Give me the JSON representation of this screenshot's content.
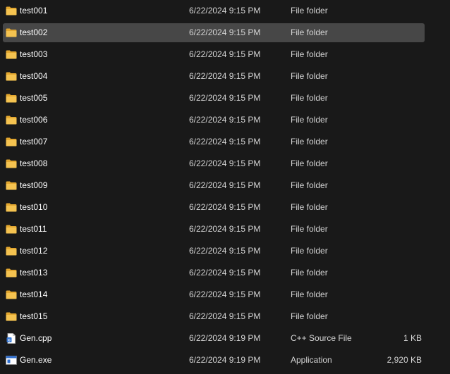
{
  "colors": {
    "background": "#191919",
    "selected_row": "#474747",
    "folder_yellow": "#f5c350",
    "text": "#ffffff"
  },
  "files": [
    {
      "name": "test001",
      "date": "6/22/2024 9:15 PM",
      "type": "File folder",
      "size": "",
      "icon": "folder-icon",
      "selected": false
    },
    {
      "name": "test002",
      "date": "6/22/2024 9:15 PM",
      "type": "File folder",
      "size": "",
      "icon": "folder-icon",
      "selected": true
    },
    {
      "name": "test003",
      "date": "6/22/2024 9:15 PM",
      "type": "File folder",
      "size": "",
      "icon": "folder-icon",
      "selected": false
    },
    {
      "name": "test004",
      "date": "6/22/2024 9:15 PM",
      "type": "File folder",
      "size": "",
      "icon": "folder-icon",
      "selected": false
    },
    {
      "name": "test005",
      "date": "6/22/2024 9:15 PM",
      "type": "File folder",
      "size": "",
      "icon": "folder-icon",
      "selected": false
    },
    {
      "name": "test006",
      "date": "6/22/2024 9:15 PM",
      "type": "File folder",
      "size": "",
      "icon": "folder-icon",
      "selected": false
    },
    {
      "name": "test007",
      "date": "6/22/2024 9:15 PM",
      "type": "File folder",
      "size": "",
      "icon": "folder-icon",
      "selected": false
    },
    {
      "name": "test008",
      "date": "6/22/2024 9:15 PM",
      "type": "File folder",
      "size": "",
      "icon": "folder-icon",
      "selected": false
    },
    {
      "name": "test009",
      "date": "6/22/2024 9:15 PM",
      "type": "File folder",
      "size": "",
      "icon": "folder-icon",
      "selected": false
    },
    {
      "name": "test010",
      "date": "6/22/2024 9:15 PM",
      "type": "File folder",
      "size": "",
      "icon": "folder-icon",
      "selected": false
    },
    {
      "name": "test011",
      "date": "6/22/2024 9:15 PM",
      "type": "File folder",
      "size": "",
      "icon": "folder-icon",
      "selected": false
    },
    {
      "name": "test012",
      "date": "6/22/2024 9:15 PM",
      "type": "File folder",
      "size": "",
      "icon": "folder-icon",
      "selected": false
    },
    {
      "name": "test013",
      "date": "6/22/2024 9:15 PM",
      "type": "File folder",
      "size": "",
      "icon": "folder-icon",
      "selected": false
    },
    {
      "name": "test014",
      "date": "6/22/2024 9:15 PM",
      "type": "File folder",
      "size": "",
      "icon": "folder-icon",
      "selected": false
    },
    {
      "name": "test015",
      "date": "6/22/2024 9:15 PM",
      "type": "File folder",
      "size": "",
      "icon": "folder-icon",
      "selected": false
    },
    {
      "name": "Gen.cpp",
      "date": "6/22/2024 9:19 PM",
      "type": "C++ Source File",
      "size": "1 KB",
      "icon": "cpp-file-icon",
      "selected": false
    },
    {
      "name": "Gen.exe",
      "date": "6/22/2024 9:19 PM",
      "type": "Application",
      "size": "2,920 KB",
      "icon": "exe-file-icon",
      "selected": false
    }
  ]
}
